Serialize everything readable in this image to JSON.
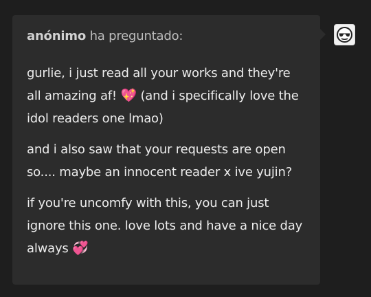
{
  "ask": {
    "asker_name": "anónimo",
    "asker_suffix": " ha preguntado:",
    "paragraphs": [
      {
        "text_before": "gurlie, i just read all your works and they're all amazing af! ",
        "emoji": "💖",
        "text_after": " (and i specifically love the idol readers one lmao)"
      },
      {
        "text": "and i also saw that your requests are open so.... maybe an innocent reader x ive yujin?"
      },
      {
        "text_before": "if you're uncomfy with this, you can just ignore this one. love lots and have a nice day always ",
        "emoji": "💞",
        "text_after": ""
      }
    ]
  },
  "avatar": {
    "icon": "anonymous-avatar-icon"
  }
}
